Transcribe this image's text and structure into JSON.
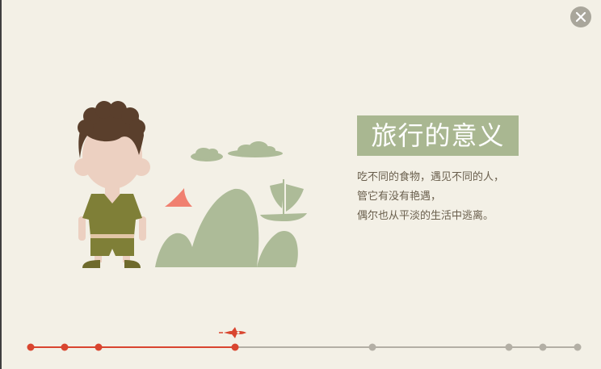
{
  "window": {
    "close_icon": "close-icon"
  },
  "slide": {
    "title": "旅行的意义",
    "lines": [
      "吃不同的食物，遇见不同的人，",
      "管它有没有艳遇，",
      "偶尔也从平淡的生活中逃离。"
    ]
  },
  "timeline": {
    "progress_marker_icon": "rocket-icon",
    "total_points": 8,
    "current_index": 3,
    "colors": {
      "active": "#d9452f",
      "inactive": "#b3afa5"
    }
  },
  "colors": {
    "background": "#f3f0e6",
    "title_bg": "#a9b791",
    "title_text": "#ffffff",
    "body_text": "#6a5f4d",
    "hills": "#adbb98",
    "boy_shirt": "#7f7f37",
    "boy_hair": "#5a3f2c",
    "boy_skin": "#ecd0c1",
    "moon": "#f08070"
  }
}
